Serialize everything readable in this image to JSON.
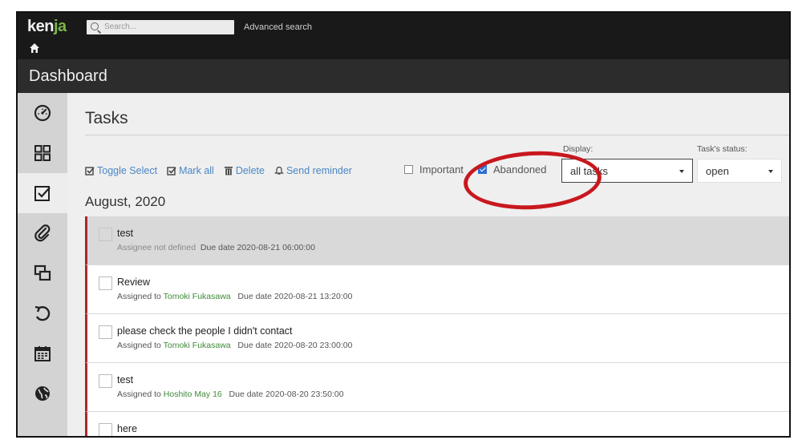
{
  "app": {
    "logo": "ken",
    "logo_accent": "ja",
    "search_placeholder": "Search...",
    "advanced_search": "Advanced search",
    "page_header": "Dashboard"
  },
  "sidebar": {
    "items": [
      {
        "icon": "gauge-icon"
      },
      {
        "icon": "grid-icon"
      },
      {
        "icon": "checkbox-icon",
        "active": true
      },
      {
        "icon": "paperclip-icon"
      },
      {
        "icon": "copy-icon"
      },
      {
        "icon": "undo-icon"
      },
      {
        "icon": "calendar-icon"
      },
      {
        "icon": "globe-icon"
      }
    ]
  },
  "tasks_page": {
    "title": "Tasks",
    "toolbar": {
      "toggle_select": "Toggle Select",
      "mark_all": "Mark all",
      "delete": "Delete",
      "send_reminder": "Send reminder"
    },
    "filters": {
      "important_label": "Important",
      "important_checked": false,
      "abandoned_label": "Abandoned",
      "abandoned_checked": true,
      "display_label": "Display:",
      "display_value": "all tasks",
      "status_label": "Task's status:",
      "status_value": "open"
    },
    "month": "August, 2020",
    "rows": [
      {
        "name": "test",
        "assignee_prefix": "Assignee not defined",
        "assignee": "",
        "due": "Due date 2020-08-21 06:00:00"
      },
      {
        "name": "Review",
        "assignee_prefix": "Assigned to",
        "assignee": "Tomoki Fukasawa",
        "due": "Due date 2020-08-21 13:20:00"
      },
      {
        "name": "please check the people I didn't contact",
        "assignee_prefix": "Assigned to",
        "assignee": "Tomoki Fukasawa",
        "due": "Due date 2020-08-20 23:00:00"
      },
      {
        "name": "test",
        "assignee_prefix": "Assigned to",
        "assignee": "Hoshito May 16",
        "due": "Due date 2020-08-20 23:50:00"
      },
      {
        "name": "here",
        "assignee_prefix": "",
        "assignee": "",
        "due": ""
      }
    ]
  },
  "colors": {
    "accent_blue": "#4a86c5",
    "annotation_red": "#c8181e",
    "task_border": "#a52a2a",
    "assignee_green": "#3f8a3a"
  }
}
